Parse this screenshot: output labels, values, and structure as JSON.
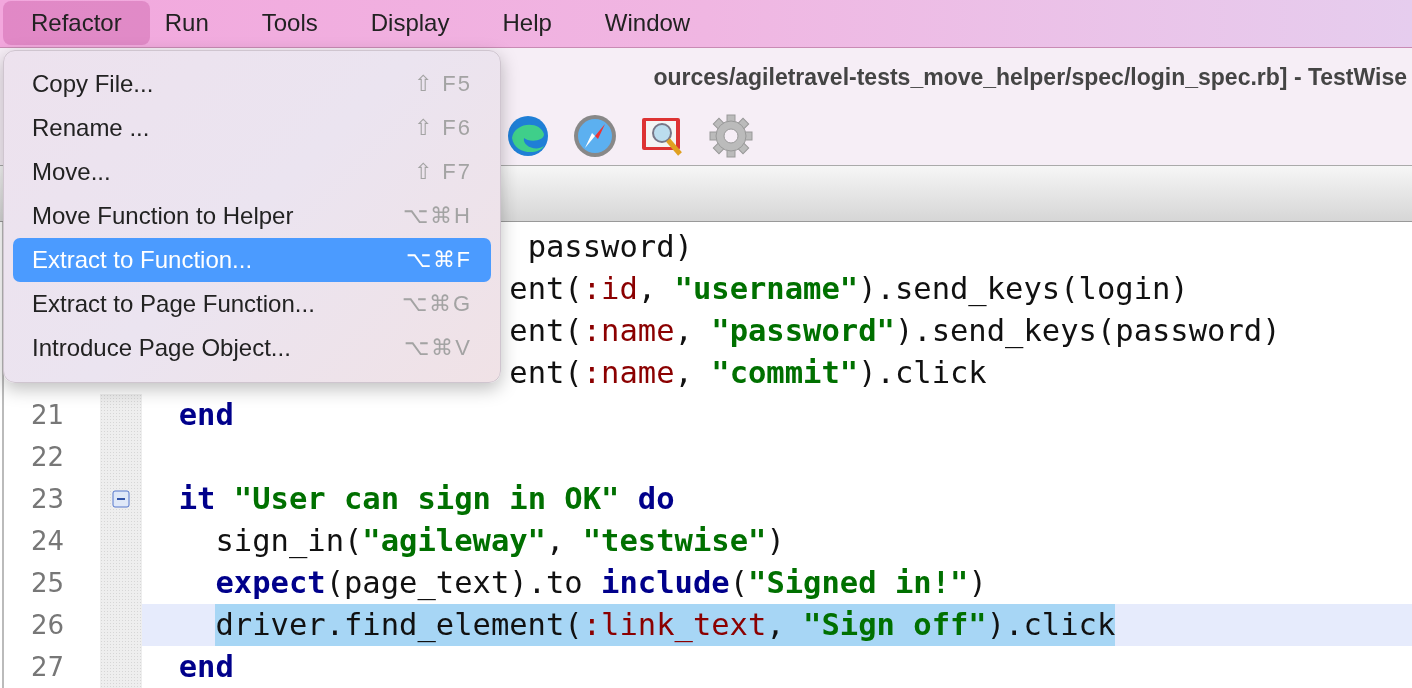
{
  "menubar": [
    {
      "label": "Refactor",
      "selected": true
    },
    {
      "label": "Run",
      "selected": false
    },
    {
      "label": "Tools",
      "selected": false
    },
    {
      "label": "Display",
      "selected": false
    },
    {
      "label": "Help",
      "selected": false
    },
    {
      "label": "Window",
      "selected": false
    }
  ],
  "window": {
    "title": "ources/agiletravel-tests_move_helper/spec/login_spec.rb] - TestWise"
  },
  "menu": {
    "items": [
      {
        "label": "Copy File...",
        "shortcut": "⇧ F5",
        "selected": false
      },
      {
        "label": "Rename ...",
        "shortcut": "⇧ F6",
        "selected": false
      },
      {
        "label": "Move...",
        "shortcut": "⇧ F7",
        "selected": false
      },
      {
        "label": "Move Function to Helper",
        "shortcut": "⌥⌘H",
        "selected": false
      },
      {
        "label": "Extract to Function...",
        "shortcut": "⌥⌘F",
        "selected": true
      },
      {
        "label": "Extract to Page Function...",
        "shortcut": "⌥⌘G",
        "selected": false
      },
      {
        "label": "Introduce Page Object...",
        "shortcut": "⌥⌘V",
        "selected": false
      }
    ]
  },
  "editor": {
    "lines": [
      {
        "tokens": [
          {
            "kind": "plain",
            "text": "password)"
          }
        ]
      },
      {
        "tokens": [
          {
            "kind": "plain",
            "text": "ent("
          },
          {
            "kind": "symbol",
            "text": ":id"
          },
          {
            "kind": "plain",
            "text": ", "
          },
          {
            "kind": "string",
            "text": "\"username\""
          },
          {
            "kind": "plain",
            "text": ").send_keys(login)"
          }
        ]
      },
      {
        "tokens": [
          {
            "kind": "plain",
            "text": "ent("
          },
          {
            "kind": "symbol",
            "text": ":name"
          },
          {
            "kind": "plain",
            "text": ", "
          },
          {
            "kind": "string",
            "text": "\"password\""
          },
          {
            "kind": "plain",
            "text": ").send_keys(password)"
          }
        ]
      },
      {
        "tokens": [
          {
            "kind": "plain",
            "text": "ent("
          },
          {
            "kind": "symbol",
            "text": ":name"
          },
          {
            "kind": "plain",
            "text": ", "
          },
          {
            "kind": "string",
            "text": "\"commit\""
          },
          {
            "kind": "plain",
            "text": ").click"
          }
        ]
      },
      {
        "number": "21",
        "current": false,
        "selected": false,
        "foldable": false,
        "tokens": [
          {
            "kind": "keyword",
            "text": "end"
          }
        ]
      },
      {
        "number": "22",
        "current": false,
        "foldable": false
      },
      {
        "number": "23",
        "current": false,
        "selected": false,
        "foldable": true,
        "tokens": [
          {
            "kind": "keyword",
            "text": "it "
          },
          {
            "kind": "string",
            "text": "\"User can sign in OK\" "
          },
          {
            "kind": "keyword",
            "text": "do"
          }
        ]
      },
      {
        "number": "24",
        "current": false,
        "selected": false,
        "foldable": false,
        "tokens": [
          {
            "kind": "plain",
            "text": "sign_in("
          },
          {
            "kind": "string",
            "text": "\"agileway\""
          },
          {
            "kind": "plain",
            "text": ", "
          },
          {
            "kind": "string",
            "text": "\"testwise\""
          },
          {
            "kind": "plain",
            "text": ")"
          }
        ]
      },
      {
        "number": "25",
        "current": false,
        "selected": false,
        "foldable": false,
        "tokens": [
          {
            "kind": "keyword",
            "text": "expect"
          },
          {
            "kind": "plain",
            "text": "(page_text).to "
          },
          {
            "kind": "keyword",
            "text": "include"
          },
          {
            "kind": "plain",
            "text": "("
          },
          {
            "kind": "string",
            "text": "\"Signed in!\""
          },
          {
            "kind": "plain",
            "text": ")"
          }
        ]
      },
      {
        "number": "26",
        "current": true,
        "selected": true,
        "foldable": false,
        "tokens": [
          {
            "kind": "plain",
            "text": "driver.find_element("
          },
          {
            "kind": "symbol",
            "text": ":link_text"
          },
          {
            "kind": "plain",
            "text": ", "
          },
          {
            "kind": "string",
            "text": "\"Sign off\""
          },
          {
            "kind": "plain",
            "text": ").click"
          }
        ]
      },
      {
        "number": "27",
        "current": false,
        "selected": false,
        "foldable": false,
        "tokens": [
          {
            "kind": "keyword",
            "text": "end"
          }
        ]
      }
    ]
  }
}
